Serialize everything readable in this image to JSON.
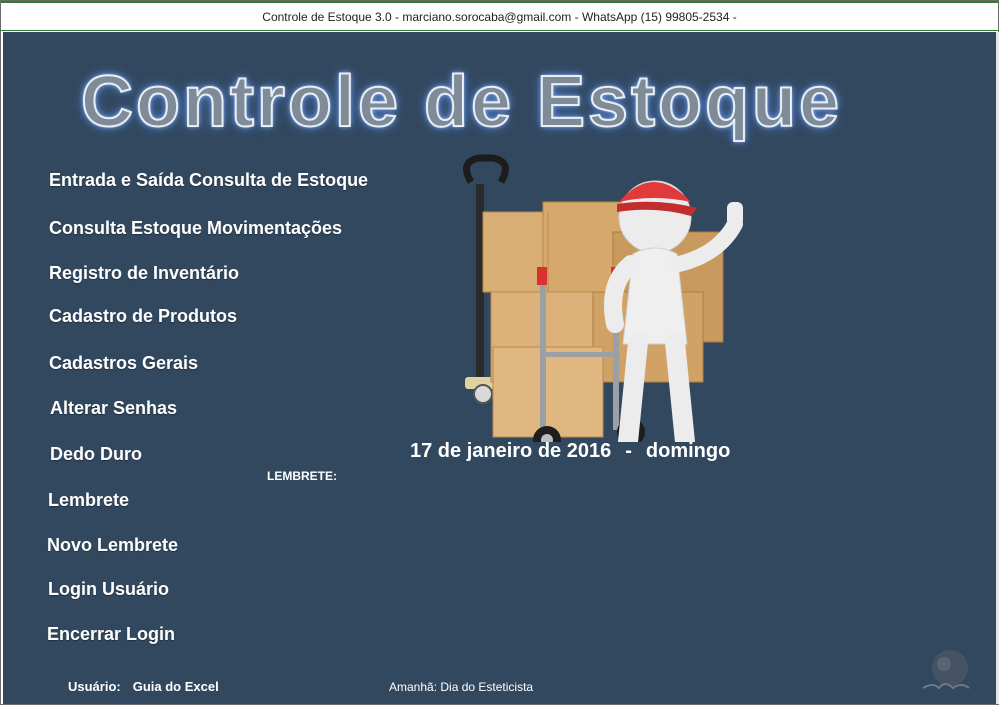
{
  "window": {
    "title": "Controle de Estoque 3.0 - marciano.sorocaba@gmail.com - WhatsApp (15) 99805-2534 -"
  },
  "header": {
    "title": "Controle de Estoque"
  },
  "menu": {
    "items": [
      {
        "label": "Entrada e Saída  Consulta de Estoque"
      },
      {
        "label": "Consulta Estoque Movimentações"
      },
      {
        "label": "Registro de Inventário"
      },
      {
        "label": "Cadastro de Produtos"
      },
      {
        "label": "Cadastros Gerais"
      },
      {
        "label": "Alterar Senhas"
      },
      {
        "label": "Dedo Duro"
      },
      {
        "label": "Lembrete"
      },
      {
        "label": "Novo Lembrete"
      },
      {
        "label": "Login Usuário"
      },
      {
        "label": "Encerrar Login"
      }
    ]
  },
  "date": {
    "date_text": "17 de janeiro de 2016",
    "separator": "-",
    "weekday": "domingo"
  },
  "reminder": {
    "label": "LEMBRETE:"
  },
  "footer": {
    "user_label": "Usuário:",
    "user_value": "Guia do Excel",
    "tomorrow_text": "Amanhã: Dia do Esteticista"
  },
  "colors": {
    "background": "#32485f",
    "title_fill": "#7f8b97",
    "text": "#ffffff"
  },
  "icons": {
    "illustration": "stock-worker-boxes-illustration",
    "logo": "watermark-logo"
  }
}
